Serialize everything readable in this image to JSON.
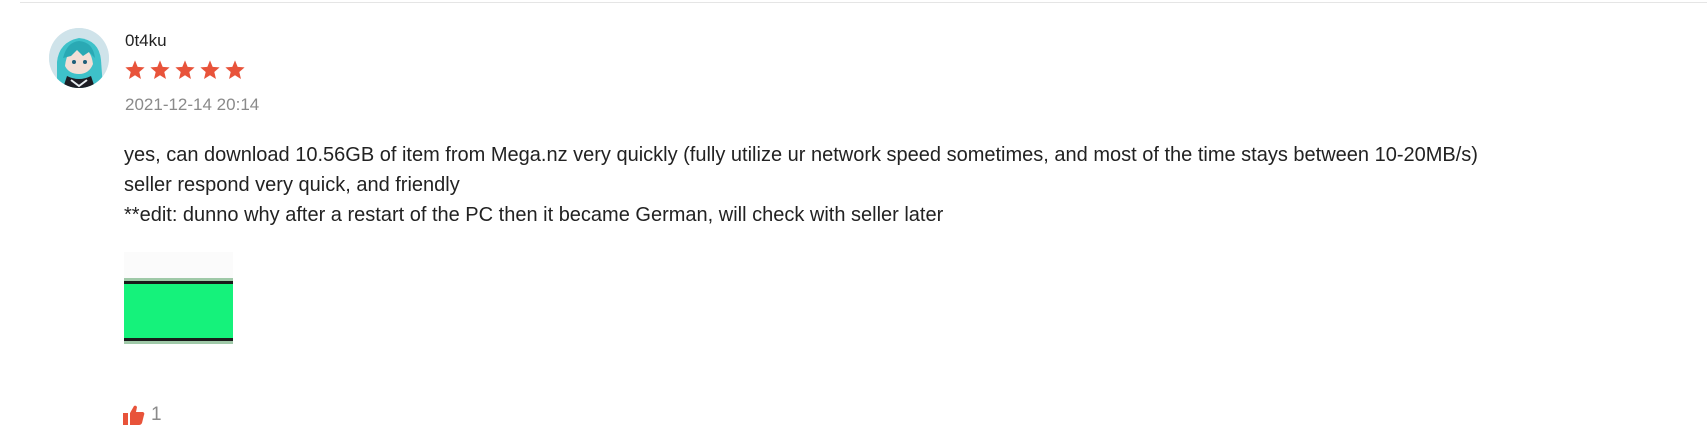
{
  "review": {
    "username": "0t4ku",
    "rating": 5,
    "rating_max": 5,
    "date": "2021-12-14 20:14",
    "text_lines": [
      "yes, can download 10.56GB of item from Mega.nz very quickly (fully utilize ur network speed sometimes, and most of the time stays between 10-20MB/s)",
      "seller respond very quick, and friendly",
      "**edit: dunno why after a restart of the PC then it became German, will check with seller later"
    ],
    "likes": "1"
  },
  "colors": {
    "star": "#e8533a",
    "like_icon": "#e8533a",
    "photo_green": "#15f27b"
  },
  "icons": {
    "star": "star-icon",
    "like": "thumbs-up-icon"
  }
}
